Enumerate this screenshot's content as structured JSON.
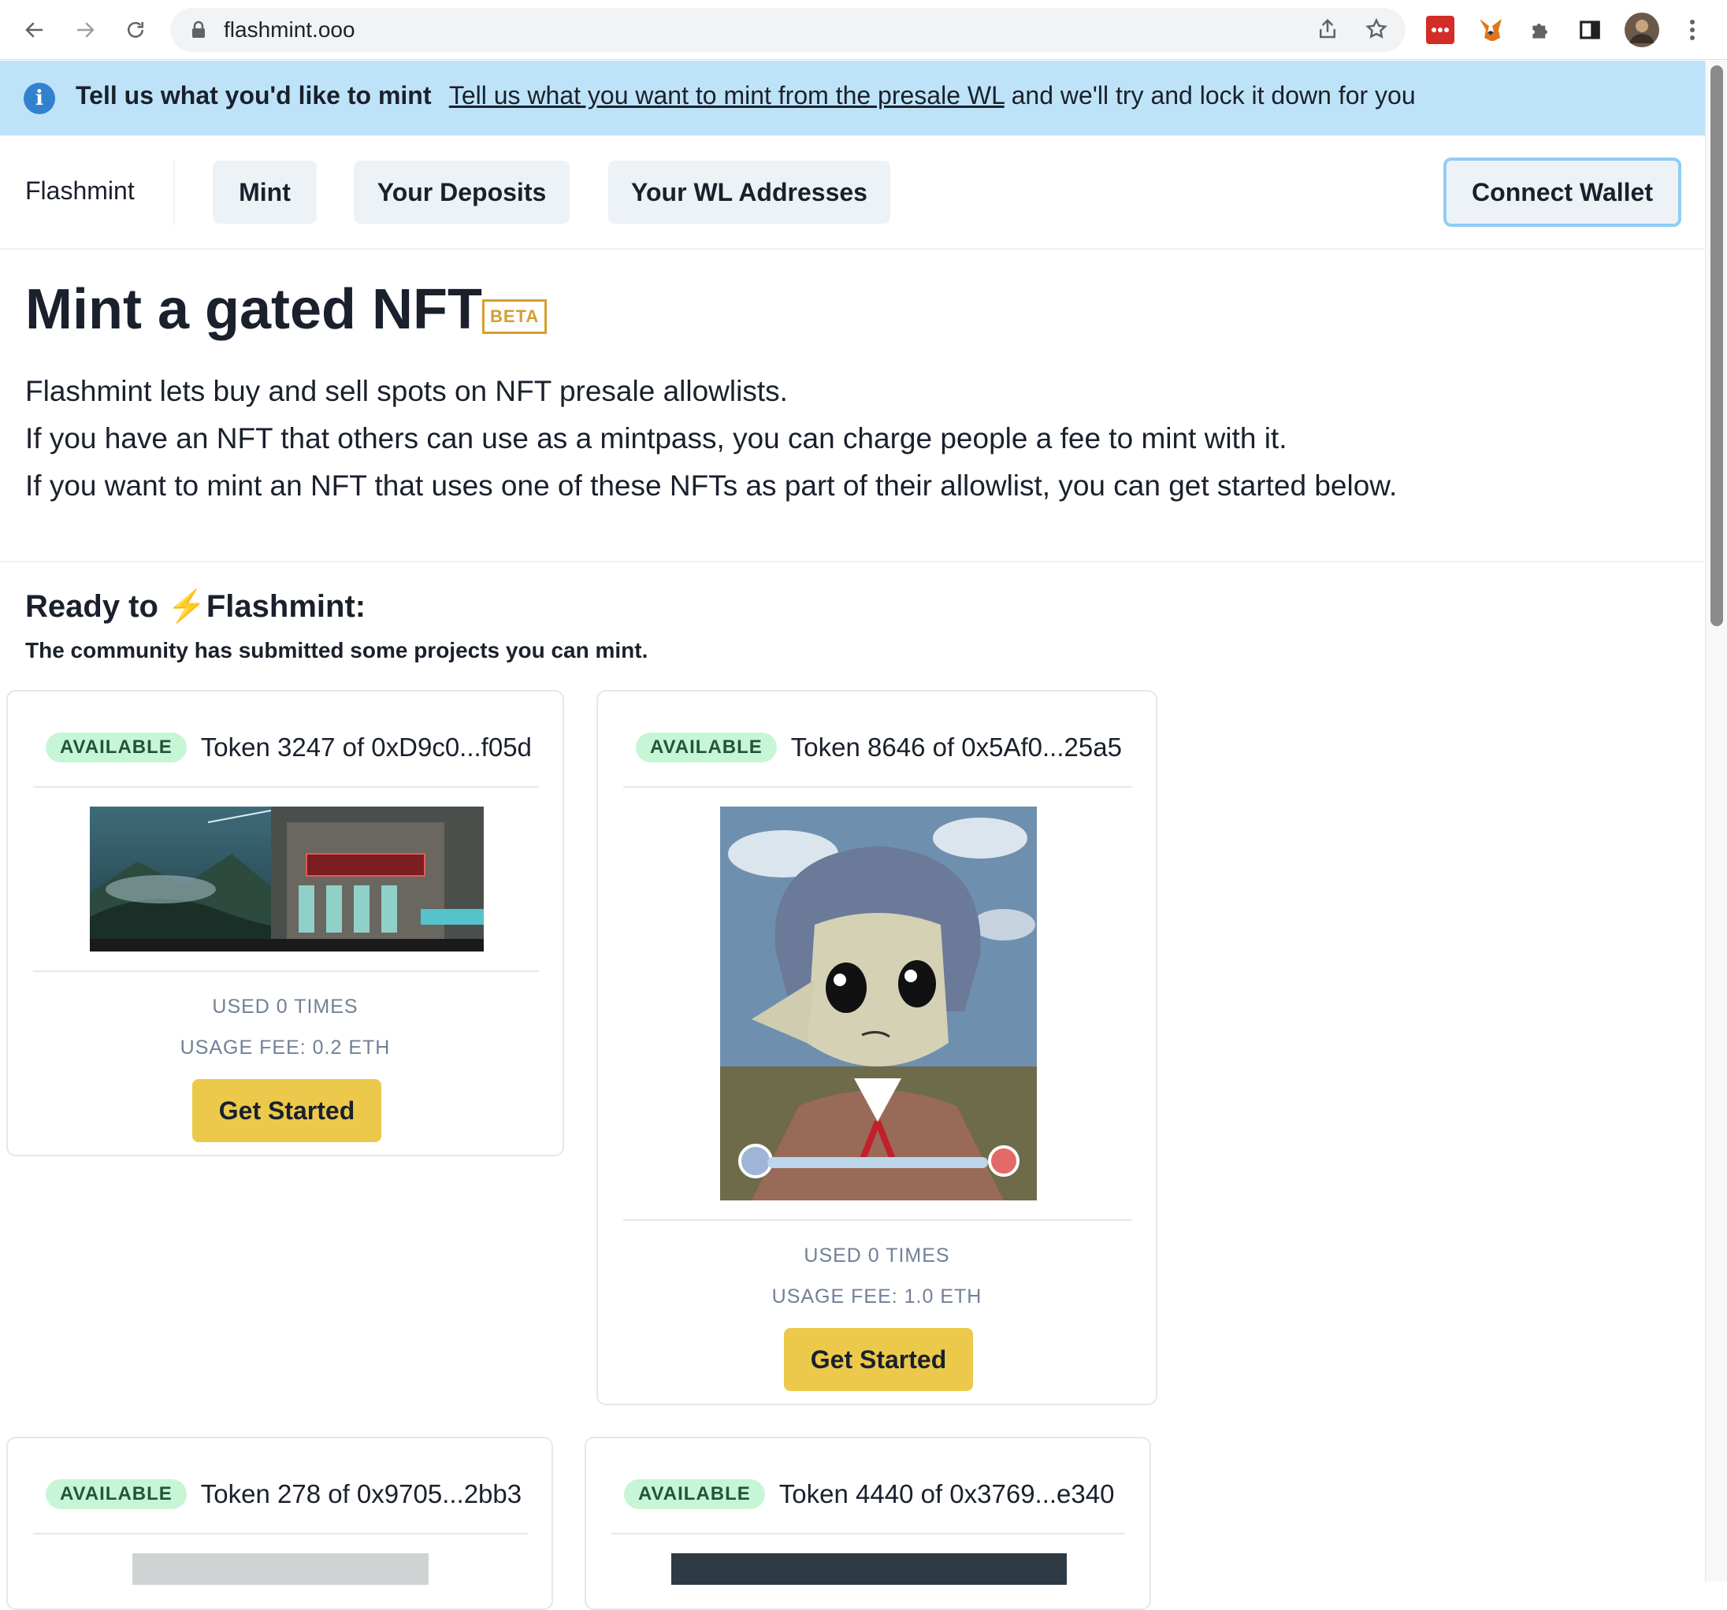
{
  "browser": {
    "url": "flashmint.ooo"
  },
  "banner": {
    "title": "Tell us what you'd like to mint",
    "link_text": "Tell us what you want to mint from the presale WL",
    "suffix": "and we'll try and lock it down for you"
  },
  "header": {
    "brand": "Flashmint",
    "nav": [
      "Mint",
      "Your Deposits",
      "Your WL Addresses"
    ],
    "connect_label": "Connect Wallet"
  },
  "hero": {
    "title": "Mint a gated NFT",
    "badge": "BETA",
    "lines": [
      "Flashmint lets buy and sell spots on NFT presale allowlists.",
      "If you have an NFT that others can use as a mintpass, you can charge people a fee to mint with it.",
      "If you want to mint an NFT that uses one of these NFTs as part of their allowlist, you can get started below."
    ]
  },
  "ready": {
    "prefix": "Ready to",
    "bolt": "⚡",
    "brand": "Flashmint:",
    "subtitle": "The community has submitted some projects you can mint."
  },
  "cards": [
    {
      "status": "AVAILABLE",
      "token": "Token 3247 of 0xD9c0...f05d",
      "used": "USED 0 TIMES",
      "fee": "USAGE FEE: 0.2 ETH",
      "button": "Get Started"
    },
    {
      "status": "AVAILABLE",
      "token": "Token 8646 of 0x5Af0...25a5",
      "used": "USED 0 TIMES",
      "fee": "USAGE FEE: 1.0 ETH",
      "button": "Get Started"
    },
    {
      "status": "AVAILABLE",
      "token": "Token 278 of 0x9705...2bb3"
    },
    {
      "status": "AVAILABLE",
      "token": "Token 4440 of 0x3769...e340"
    }
  ],
  "colors": {
    "banner_bg": "#bee3f8",
    "badge_bg": "#c6f6d5",
    "cta": "#ecc94b",
    "beta": "#d69e2e"
  }
}
